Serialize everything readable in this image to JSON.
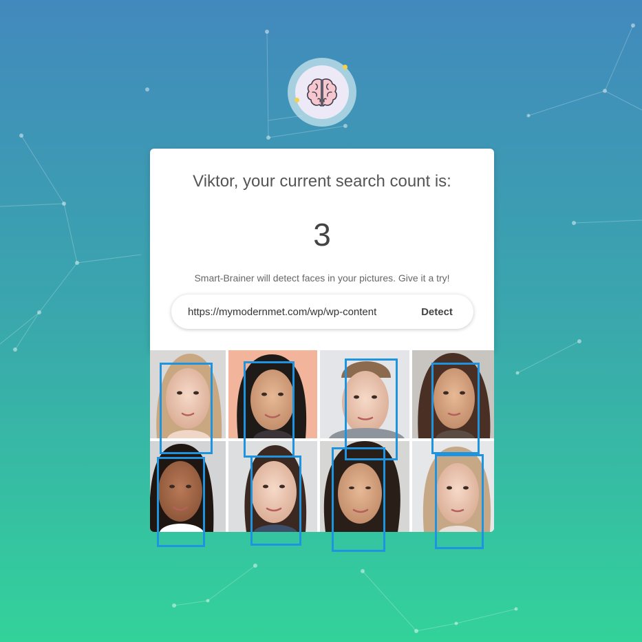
{
  "header": {
    "logo_icon": "brain-icon"
  },
  "card": {
    "greeting": "Viktor, your current search count is:",
    "count": "3",
    "tagline": "Smart-Brainer will detect faces in your pictures. Give it a try!"
  },
  "search": {
    "url_value": "https://mymodernmet.com/wp/wp-content",
    "detect_label": "Detect"
  },
  "result": {
    "image_description_icon": "face-grid-image",
    "detected_faces": 8
  },
  "colors": {
    "bg_top": "#4289bd",
    "bg_bottom": "#33d29a",
    "box": "#1e93e0"
  }
}
